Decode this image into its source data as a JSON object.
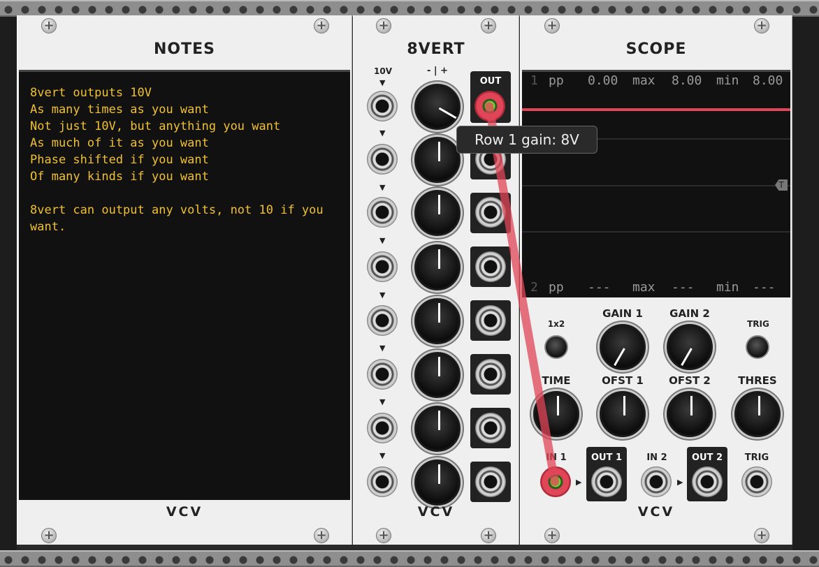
{
  "notes": {
    "title": "NOTES",
    "text": "8vert outputs 10V\nAs many times as you want\nNot just 10V, but anything you want\nAs much of it as you want\nPhase shifted if you want\nOf many kinds if you want\n\n8vert can output any volts, not 10 if you want.",
    "logo": "VCV"
  },
  "eightvert": {
    "title": "8VERT",
    "label_10v": "10V",
    "label_gain": "- | +",
    "label_out": "OUT",
    "logo": "VCV"
  },
  "tooltip": {
    "text": "Row 1 gain: 8V"
  },
  "scope": {
    "title": "SCOPE",
    "channel1": {
      "num": "1",
      "pp_label": "pp",
      "pp": "0.00",
      "max_label": "max",
      "max": "8.00",
      "min_label": "min",
      "min": "8.00"
    },
    "channel2": {
      "num": "2",
      "pp_label": "pp",
      "pp": "---",
      "max_label": "max",
      "max": "---",
      "min_label": "min",
      "min": "---"
    },
    "trigger_marker": "T",
    "labels": {
      "x1x2": "1x2",
      "gain1": "GAIN 1",
      "gain2": "GAIN 2",
      "trig": "TRIG",
      "time": "TIME",
      "ofst1": "OFST 1",
      "ofst2": "OFST 2",
      "thres": "THRES",
      "in1": "IN 1",
      "out1": "OUT 1",
      "in2": "IN 2",
      "out2": "OUT 2",
      "trig_in": "TRIG"
    },
    "logo": "VCV",
    "trace_color": "#e04658"
  },
  "cable_color": "#e04658"
}
